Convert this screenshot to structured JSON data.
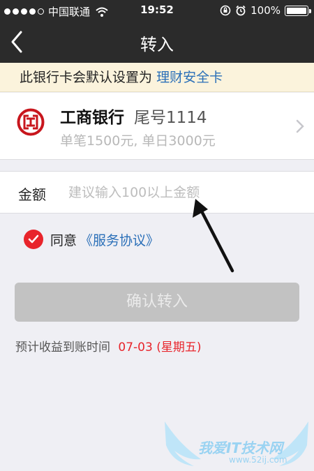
{
  "status_bar": {
    "carrier": "中国联通",
    "time": "19:52",
    "battery": "100%",
    "battery_level": 1.0
  },
  "nav": {
    "title": "转入",
    "back_icon": "chevron-left-icon"
  },
  "notice": {
    "text": "此银行卡会默认设置为",
    "link": "理财安全卡"
  },
  "bank_card": {
    "name": "工商银行",
    "tail": "尾号1114",
    "limit": "单笔1500元, 单日3000元",
    "logo_icon": "icbc-logo-icon",
    "logo_color": "#c8161d"
  },
  "amount": {
    "label": "金额",
    "placeholder": "建议输入100以上金额",
    "value": ""
  },
  "agreement": {
    "checked": true,
    "prefix": "同意",
    "link": "《服务协议》"
  },
  "confirm_button": {
    "label": "确认转入",
    "enabled": false
  },
  "eta": {
    "label": "预计收益到账时间",
    "date": "07-03 (星期五)"
  },
  "watermark": {
    "main": "我爱IT技术网",
    "url": "www.52ij.com"
  },
  "colors": {
    "accent_red": "#e8242b",
    "link_blue": "#2a6fb8",
    "nav_bg": "#2b2b2b",
    "notice_bg": "#fbf3dc"
  }
}
